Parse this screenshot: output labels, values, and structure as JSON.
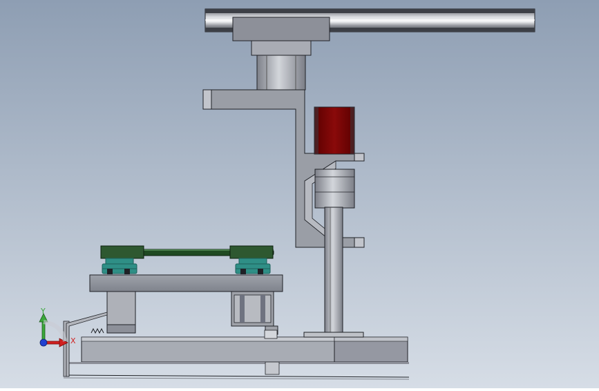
{
  "viewport": {
    "background_top": "#8e9eb3",
    "background_bottom": "#d6dde6"
  },
  "colors": {
    "steel_light": "#c9ccd3",
    "steel_mid": "#a2a6ae",
    "steel_dark": "#6f7380",
    "outline": "#1f2126",
    "motor_red": "#7a0000",
    "motor_red_light": "#9a1010",
    "belt_green": "#1f4a22",
    "pulley_teal": "#2f8f86",
    "pulley_teal_dark": "#1c5f5a",
    "triad_y": "#3aa83a",
    "triad_x": "#d02020",
    "triad_z": "#2040d0"
  },
  "triad": {
    "y_label": "Y",
    "x_label": "X"
  }
}
